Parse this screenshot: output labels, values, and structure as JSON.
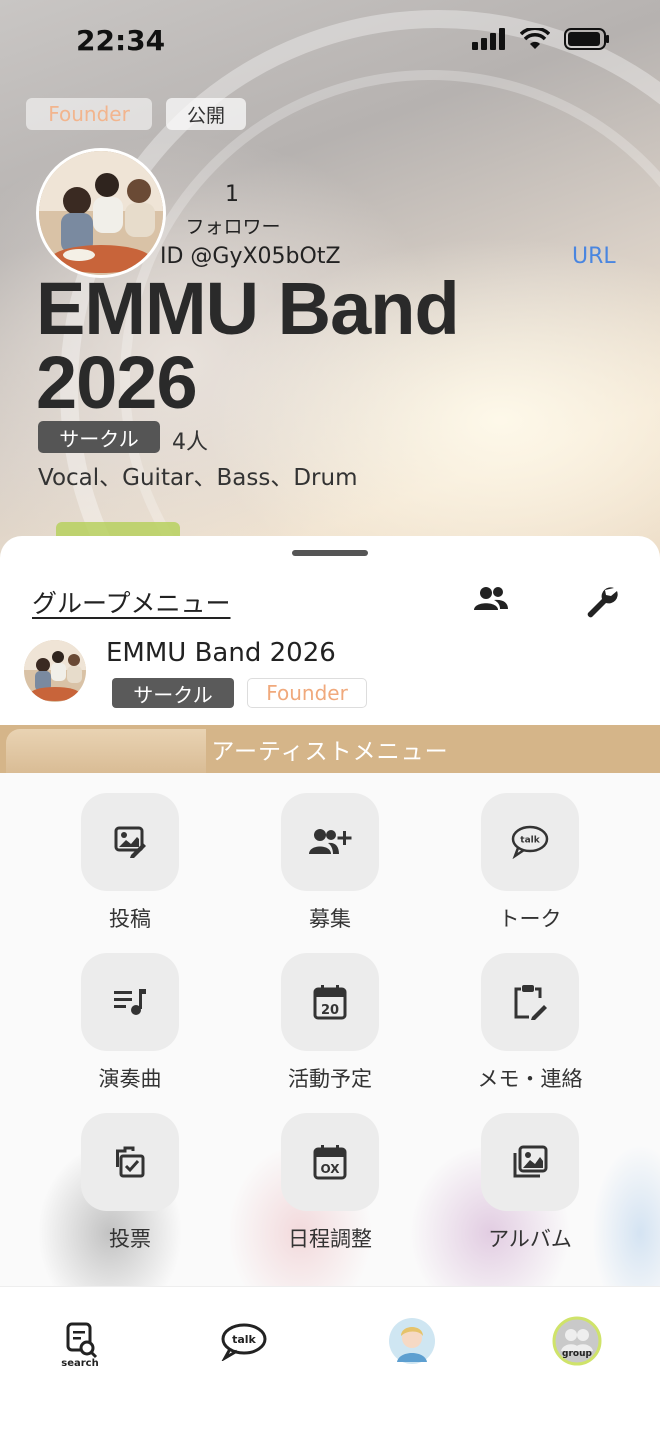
{
  "status_bar": {
    "time": "22:34"
  },
  "header": {
    "founder_badge": "Founder",
    "public_badge": "公開",
    "followers_count": "1",
    "followers_label": "フォロワー",
    "group_id": "ID @GyX05bOtZ",
    "url_label": "URL",
    "group_title": "EMMU Band 2026",
    "category": "サークル",
    "member_count": "4人",
    "parts": "Vocal、Guitar、Bass、Drum"
  },
  "group_menu": {
    "title": "グループメニュー",
    "group_name": "EMMU Band 2026",
    "category": "サークル",
    "role": "Founder"
  },
  "artist_menu": {
    "title": "アーティストメニュー",
    "items": [
      {
        "label": "投稿",
        "icon": "post-image-edit-icon"
      },
      {
        "label": "募集",
        "icon": "recruit-add-user-icon"
      },
      {
        "label": "トーク",
        "icon": "talk-bubble-icon"
      },
      {
        "label": "演奏曲",
        "icon": "music-list-icon"
      },
      {
        "label": "活動予定",
        "icon": "calendar-20-icon"
      },
      {
        "label": "メモ・連絡",
        "icon": "clipboard-edit-icon"
      },
      {
        "label": "投票",
        "icon": "vote-checklist-icon"
      },
      {
        "label": "日程調整",
        "icon": "schedule-ox-icon"
      },
      {
        "label": "アルバム",
        "icon": "album-photos-icon"
      }
    ]
  },
  "tab_bar": {
    "search_label": "search",
    "talk_label": "talk",
    "group_label": "group"
  },
  "colors": {
    "accent_gold": "#d5b589",
    "link_blue": "#4a86e0",
    "founder_orange": "#f0a97c"
  }
}
